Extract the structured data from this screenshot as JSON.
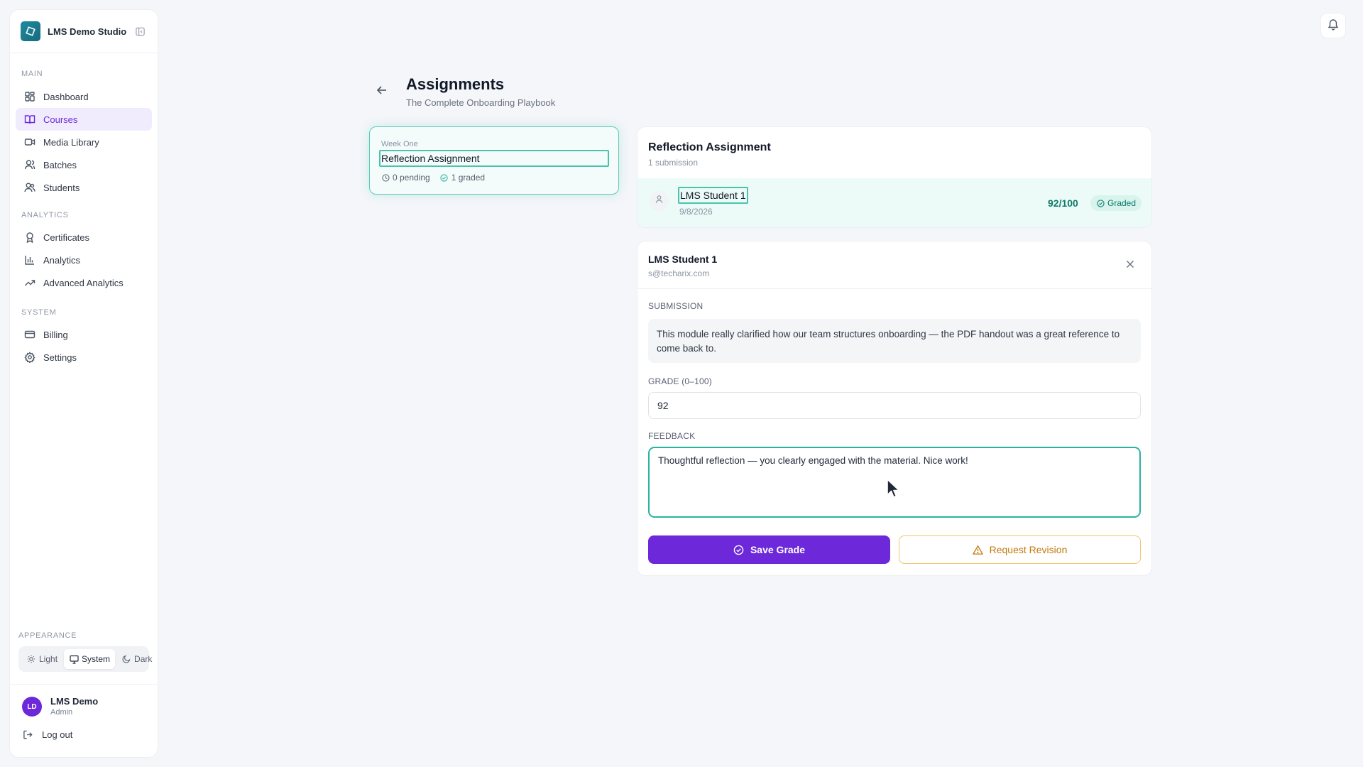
{
  "app": {
    "name": "LMS Demo Studio"
  },
  "sidebar": {
    "sections": [
      {
        "label": "MAIN",
        "items": [
          {
            "label": "Dashboard",
            "icon": "dashboard-icon",
            "active": false
          },
          {
            "label": "Courses",
            "icon": "book-icon",
            "active": true
          },
          {
            "label": "Media Library",
            "icon": "video-icon",
            "active": false
          },
          {
            "label": "Batches",
            "icon": "batches-icon",
            "active": false
          },
          {
            "label": "Students",
            "icon": "users-icon",
            "active": false
          }
        ]
      },
      {
        "label": "ANALYTICS",
        "items": [
          {
            "label": "Certificates",
            "icon": "award-icon",
            "active": false
          },
          {
            "label": "Analytics",
            "icon": "bar-chart-icon",
            "active": false
          },
          {
            "label": "Advanced Analytics",
            "icon": "trending-up-icon",
            "active": false
          }
        ]
      },
      {
        "label": "SYSTEM",
        "items": [
          {
            "label": "Billing",
            "icon": "credit-card-icon",
            "active": false
          },
          {
            "label": "Settings",
            "icon": "gear-icon",
            "active": false
          }
        ]
      }
    ],
    "appearance": {
      "label": "APPEARANCE",
      "options": [
        {
          "label": "Light",
          "icon": "sun-icon"
        },
        {
          "label": "System",
          "icon": "monitor-icon"
        },
        {
          "label": "Dark",
          "icon": "moon-icon"
        }
      ],
      "selected": "System"
    },
    "user": {
      "initials": "LD",
      "name": "LMS Demo",
      "role": "Admin"
    },
    "logout_label": "Log out"
  },
  "header": {
    "title": "Assignments",
    "subtitle": "The Complete Onboarding Playbook"
  },
  "assignment": {
    "week": "Week One",
    "title": "Reflection Assignment",
    "pending": "0 pending",
    "graded": "1 graded"
  },
  "submissions": {
    "title": "Reflection Assignment",
    "count": "1 submission",
    "rows": [
      {
        "name": "LMS Student 1",
        "date": "9/8/2026",
        "score": "92/100",
        "status": "Graded"
      }
    ]
  },
  "grading": {
    "student_name": "LMS Student 1",
    "student_email": "s@techarix.com",
    "submission_label": "SUBMISSION",
    "submission_text": "This module really clarified how our team structures onboarding — the PDF handout was a great reference to come back to.",
    "grade_label": "GRADE (0–100)",
    "grade_value": "92",
    "feedback_label": "FEEDBACK",
    "feedback_value": "Thoughtful reflection — you clearly engaged with the material. Nice work!",
    "save_label": "Save Grade",
    "revision_label": "Request Revision"
  },
  "colors": {
    "accent": "#6d28d9",
    "teal": "#2ab3a0",
    "warning": "#c4780d"
  }
}
